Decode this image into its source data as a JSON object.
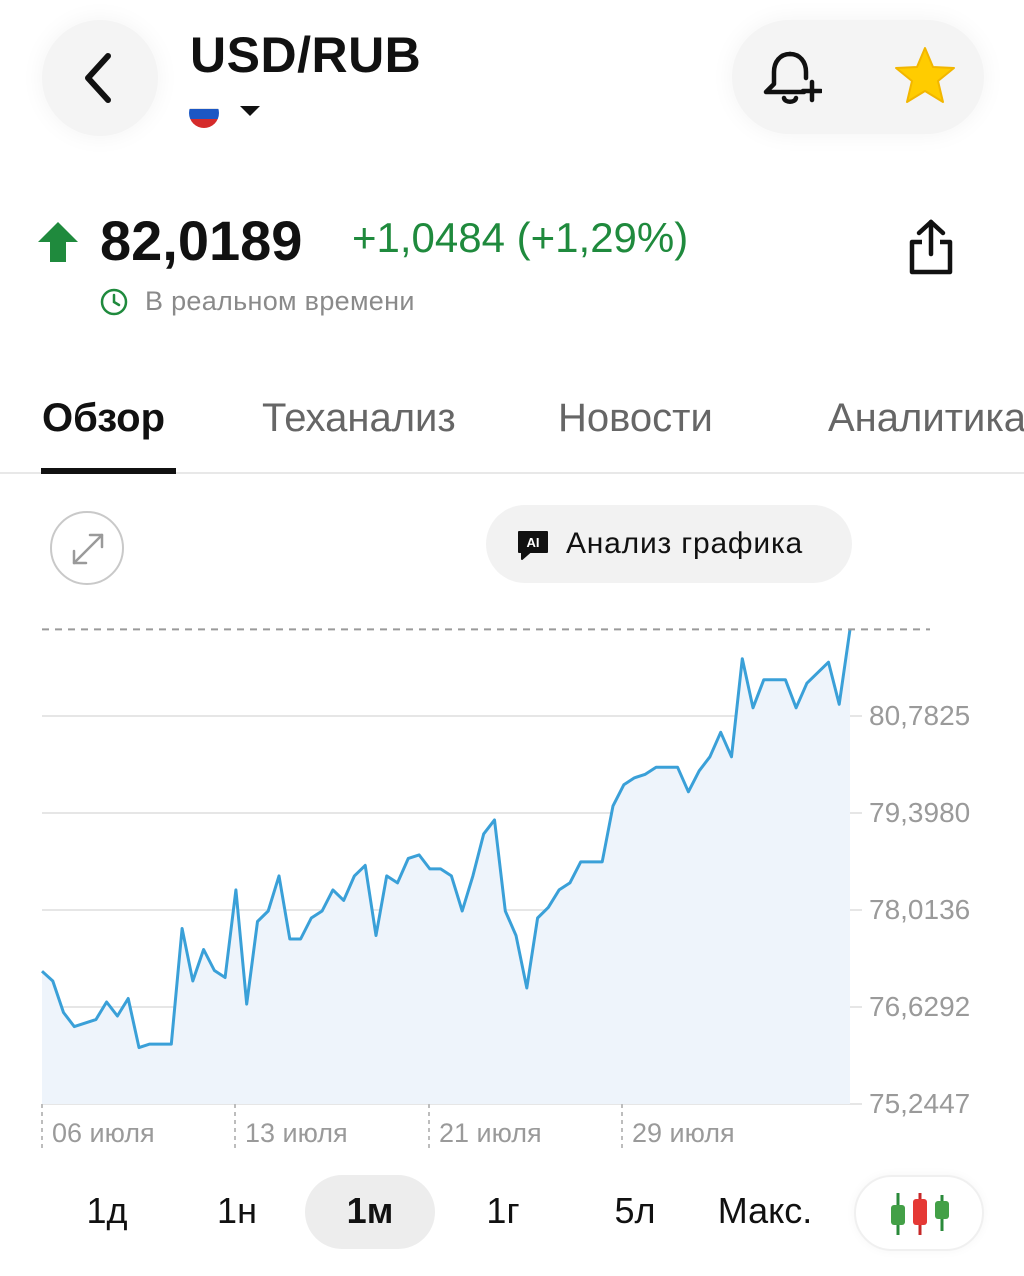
{
  "header": {
    "back_icon": "chevron-left-icon",
    "title": "USD/RUB",
    "flag_icon": "russia-flag-icon",
    "bell_icon": "bell-plus-icon",
    "star_icon": "star-icon",
    "star_color": "#FFCC00"
  },
  "quote": {
    "trend_icon": "arrow-up-icon",
    "price": "82,0189",
    "change": "+1,0484 (+1,29%)",
    "realtime_label": "В реальном времени",
    "share_icon": "share-icon",
    "positive_color": "#1F8A3D"
  },
  "tabs": [
    {
      "label": "Обзор",
      "active": true
    },
    {
      "label": "Теханализ",
      "active": false
    },
    {
      "label": "Новости",
      "active": false
    },
    {
      "label": "Аналитика",
      "active": false
    }
  ],
  "chart_controls": {
    "expand_icon": "expand-icon",
    "ai_icon": "ai-chat-icon",
    "ai_badge": "AI",
    "ai_button_label": "Анализ графика"
  },
  "chart_data": {
    "type": "area",
    "y_tick_labels": [
      "80,7825",
      "79,3980",
      "78,0136",
      "76,6292",
      "75,2447"
    ],
    "y_ticks": [
      80.7825,
      79.398,
      78.0136,
      76.6292,
      75.2447
    ],
    "ylim": [
      75.2447,
      82.0189
    ],
    "x_tick_labels": [
      "06 июля",
      "13 июля",
      "21 июля",
      "29 июля"
    ],
    "last_value_line": 82.0189,
    "line_color": "#3AA0D8",
    "fill_color": "#EEF4FB",
    "grid": true,
    "values": [
      77.14,
      77.0,
      76.55,
      76.35,
      76.4,
      76.45,
      76.7,
      76.5,
      76.75,
      76.05,
      76.1,
      76.1,
      76.1,
      77.75,
      77.0,
      77.45,
      77.15,
      77.05,
      78.3,
      76.67,
      77.85,
      78.0,
      78.5,
      77.6,
      77.6,
      77.9,
      78.0,
      78.3,
      78.15,
      78.5,
      78.65,
      77.65,
      78.5,
      78.4,
      78.75,
      78.8,
      78.6,
      78.6,
      78.5,
      78.0,
      78.5,
      79.1,
      79.3,
      78.0,
      77.65,
      76.9,
      77.9,
      78.05,
      78.3,
      78.4,
      78.7,
      78.7,
      78.7,
      79.5,
      79.8,
      79.9,
      79.95,
      80.05,
      80.05,
      80.05,
      79.7,
      80.0,
      80.2,
      80.55,
      80.2,
      81.6,
      80.9,
      81.3,
      81.3,
      81.3,
      80.9,
      81.25,
      81.4,
      81.55,
      80.95,
      82.0189
    ]
  },
  "ranges": [
    {
      "label": "1д",
      "active": false
    },
    {
      "label": "1н",
      "active": false
    },
    {
      "label": "1м",
      "active": true
    },
    {
      "label": "1г",
      "active": false
    },
    {
      "label": "5л",
      "active": false
    },
    {
      "label": "Макс.",
      "active": false
    }
  ],
  "chart_type_icon": "candlestick-icon"
}
